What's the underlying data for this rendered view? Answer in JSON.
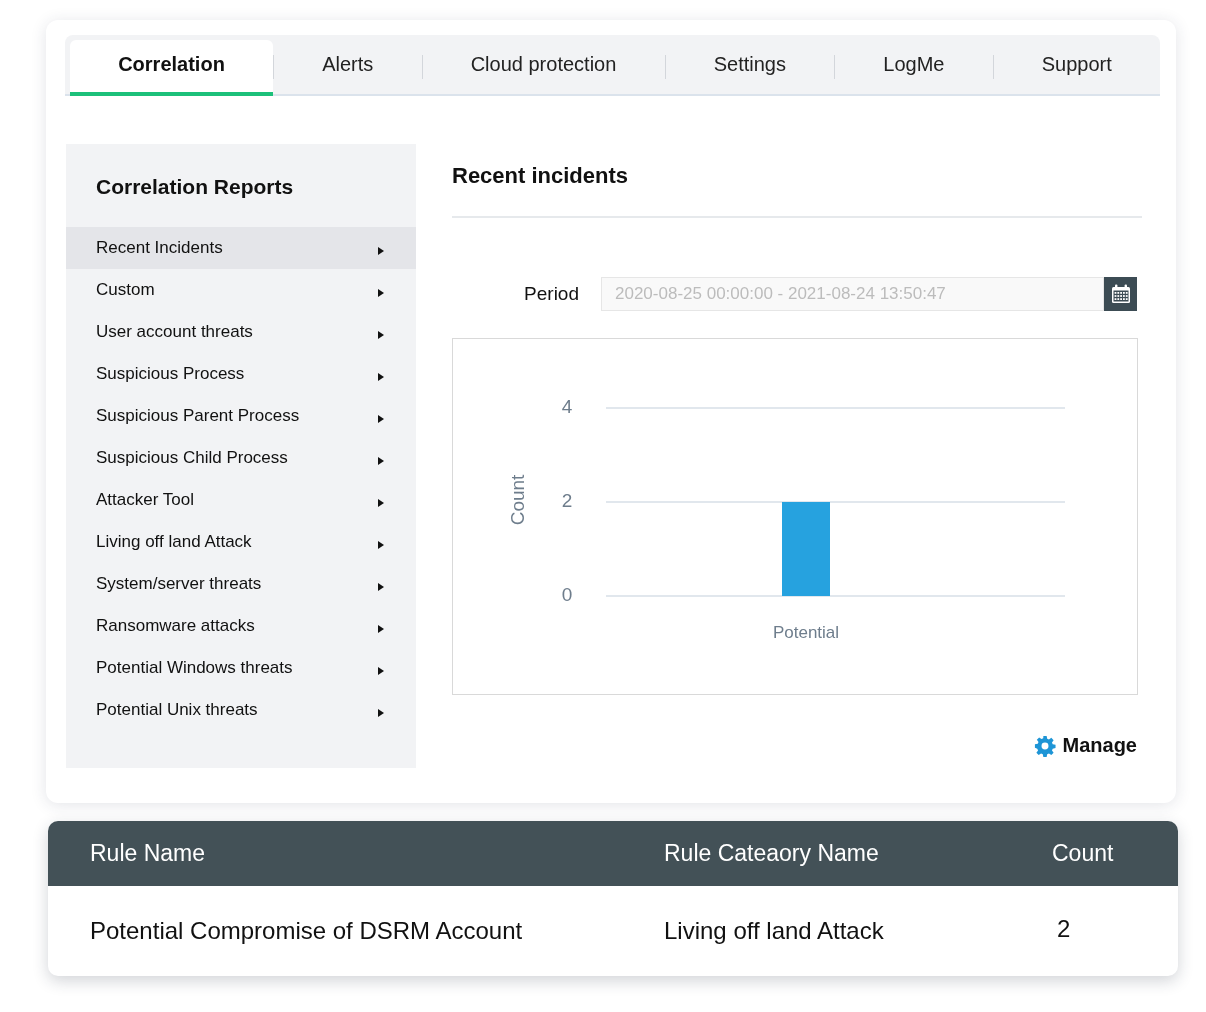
{
  "tabs": [
    {
      "label": "Correlation",
      "selected": true
    },
    {
      "label": "Alerts",
      "selected": false
    },
    {
      "label": "Cloud protection",
      "selected": false
    },
    {
      "label": "Settings",
      "selected": false
    },
    {
      "label": "LogMe",
      "selected": false
    },
    {
      "label": "Support",
      "selected": false
    }
  ],
  "sidebar": {
    "title": "Correlation Reports",
    "items": [
      {
        "label": "Recent Incidents",
        "selected": true
      },
      {
        "label": "Custom",
        "selected": false
      },
      {
        "label": "User account threats",
        "selected": false
      },
      {
        "label": "Suspicious Process",
        "selected": false
      },
      {
        "label": "Suspicious Parent Process",
        "selected": false
      },
      {
        "label": "Suspicious Child Process",
        "selected": false
      },
      {
        "label": "Attacker Tool",
        "selected": false
      },
      {
        "label": "Living off land Attack",
        "selected": false
      },
      {
        "label": "System/server threats",
        "selected": false
      },
      {
        "label": "Ransomware attacks",
        "selected": false
      },
      {
        "label": "Potential Windows threats",
        "selected": false
      },
      {
        "label": "Potential Unix threats",
        "selected": false
      }
    ]
  },
  "incidents": {
    "title": "Recent incidents",
    "period": {
      "label": "Period",
      "value": "2020-08-25 00:00:00 - 2021-08-24 13:50:47",
      "disabled": true
    },
    "chart_data": {
      "type": "bar",
      "ylabel": "Count",
      "categories": [
        "Potential"
      ],
      "values": [
        2
      ],
      "ylim": [
        0,
        4
      ],
      "yticks": [
        0,
        2,
        4
      ]
    },
    "manage": {
      "label": "Manage"
    }
  },
  "table": {
    "columns": [
      "Rule Name",
      "Rule Cateaory Name",
      "Count"
    ],
    "rows": [
      [
        "Potential Compromise of DSRM Account",
        "Living off land Attack",
        "2"
      ]
    ]
  }
}
